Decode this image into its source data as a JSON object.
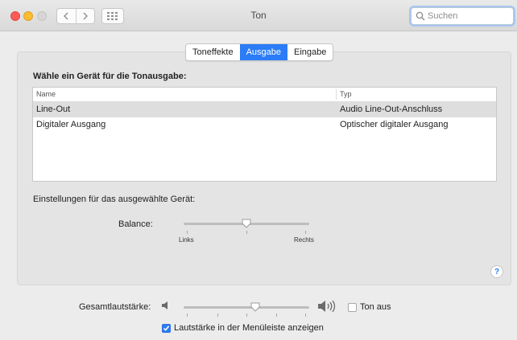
{
  "window": {
    "title": "Ton"
  },
  "search": {
    "placeholder": "Suchen"
  },
  "tabs": [
    {
      "label": "Toneffekte",
      "active": false
    },
    {
      "label": "Ausgabe",
      "active": true
    },
    {
      "label": "Eingabe",
      "active": false
    }
  ],
  "output": {
    "heading": "Wähle ein Gerät für die Tonausgabe:",
    "columns": {
      "name": "Name",
      "type": "Typ"
    },
    "devices": [
      {
        "name": "Line-Out",
        "type": "Audio Line-Out-Anschluss",
        "selected": true
      },
      {
        "name": "Digitaler Ausgang",
        "type": "Optischer digitaler Ausgang",
        "selected": false
      }
    ],
    "settings_label": "Einstellungen für das ausgewählte Gerät:",
    "balance": {
      "label": "Balance:",
      "left_label": "Links",
      "right_label": "Rechts",
      "value": 0.5
    }
  },
  "footer": {
    "volume_label": "Gesamtlautstärke:",
    "volume_value": 0.58,
    "mute_label": "Ton aus",
    "mute_checked": false,
    "menubar_label": "Lautstärke in der Menüleiste anzeigen",
    "menubar_checked": true
  },
  "colors": {
    "accent": "#2b7cf6"
  },
  "icons": {
    "close": "close-icon",
    "minimize": "minimize-icon",
    "zoom": "zoom-icon",
    "back": "chevron-left-icon",
    "forward": "chevron-right-icon",
    "grid": "grid-icon",
    "search": "search-icon",
    "help": "help-icon",
    "volume_low": "speaker-low-icon",
    "volume_high": "speaker-high-icon"
  }
}
